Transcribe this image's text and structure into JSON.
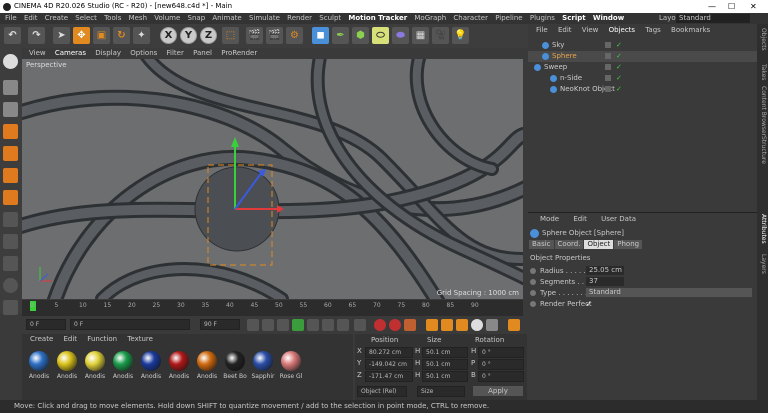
{
  "window": {
    "title": "CINEMA 4D R20.026 Studio (RC - R20) - [new648.c4d *] - Main"
  },
  "menu": [
    "File",
    "Edit",
    "Create",
    "Select",
    "Tools",
    "Mesh",
    "Volume",
    "Snap",
    "Animate",
    "Simulate",
    "Render",
    "Sculpt",
    "Motion Tracker",
    "MoGraph",
    "Character",
    "Pipeline",
    "Plugins",
    "Script",
    "Window"
  ],
  "layout": {
    "label": "Layout:",
    "value": "Standard"
  },
  "toolbar": {
    "x": "X",
    "y": "Y",
    "z": "Z"
  },
  "viewport": {
    "menu": [
      "View",
      "Cameras",
      "Display",
      "Options",
      "Filter",
      "Panel",
      "ProRender"
    ],
    "camera_label": "Perspective",
    "grid_spacing": "Grid Spacing : 1000 cm"
  },
  "timeline": {
    "ticks": [
      "0",
      "5",
      "10",
      "15",
      "20",
      "25",
      "30",
      "35",
      "40",
      "45",
      "50",
      "55",
      "60",
      "65",
      "70",
      "75",
      "80",
      "85",
      "90"
    ],
    "end_label": "0 F"
  },
  "playback": {
    "start": "0 F",
    "current": "0 F",
    "end": "90 F",
    "max": "90 F"
  },
  "materials": {
    "menu": [
      "Create",
      "Edit",
      "Function",
      "Texture"
    ],
    "items": [
      {
        "label": "Anodis",
        "color": "#2d6fc4"
      },
      {
        "label": "Anodis",
        "color": "#d9c21a"
      },
      {
        "label": "Anodis",
        "color": "#e0d23a"
      },
      {
        "label": "Anodis",
        "color": "#1a9c4a"
      },
      {
        "label": "Anodis",
        "color": "#1a3a9c"
      },
      {
        "label": "Anodis",
        "color": "#b01818"
      },
      {
        "label": "Anodis",
        "color": "#d06a10"
      },
      {
        "label": "Beet Bo",
        "color": "#222222"
      },
      {
        "label": "Sapphir",
        "color": "#2a4ea8"
      },
      {
        "label": "Rose Gl",
        "color": "#d97a7a"
      }
    ]
  },
  "coords": {
    "headers": [
      "Position",
      "Size",
      "Rotation"
    ],
    "rows": [
      {
        "axis": "X",
        "pos": "80.272 cm",
        "size_axis": "H",
        "size": "50.1 cm",
        "rot_axis": "H",
        "rot": "0 °"
      },
      {
        "axis": "Y",
        "pos": "-149.042 cm",
        "size_axis": "H",
        "size": "50.1 cm",
        "rot_axis": "P",
        "rot": "0 °"
      },
      {
        "axis": "Z",
        "pos": "-171.47 cm",
        "size_axis": "H",
        "size": "50.1 cm",
        "rot_axis": "B",
        "rot": "0 °"
      }
    ],
    "mode": "Object (Rel)",
    "size_mode": "Size",
    "apply": "Apply"
  },
  "objects": {
    "menu": [
      "File",
      "Edit",
      "View",
      "Objects",
      "Tags",
      "Bookmarks"
    ],
    "items": [
      {
        "name": "Sky",
        "indent": 1,
        "color": "#ccc"
      },
      {
        "name": "Sphere",
        "indent": 1,
        "color": "#e8a54a"
      },
      {
        "name": "Sweep",
        "indent": 0,
        "color": "#ccc"
      },
      {
        "name": "n-Side",
        "indent": 2,
        "color": "#ccc"
      },
      {
        "name": "NeoKnot Object",
        "indent": 2,
        "color": "#ccc"
      }
    ]
  },
  "attributes": {
    "menu": [
      "Mode",
      "Edit",
      "User Data"
    ],
    "object_title": "Sphere Object [Sphere]",
    "tabs": [
      "Basic",
      "Coord.",
      "Object",
      "Phong"
    ],
    "active_tab": "Object",
    "section": "Object Properties",
    "props": [
      {
        "label": "Radius . . . . . . . .",
        "value": "25.05 cm"
      },
      {
        "label": "Segments . . . . . .",
        "value": "37"
      },
      {
        "label": "Type . . . . . . . . . .",
        "value": "Standard"
      },
      {
        "label": "Render Perfect",
        "value": "✓"
      }
    ]
  },
  "right_tabs": [
    "Objects",
    "Takes",
    "Content Browser",
    "Structure",
    "Attributes",
    "Layers"
  ],
  "status": "Move: Click and drag to move elements. Hold down SHIFT to quantize movement / add to the selection in point mode, CTRL to remove."
}
